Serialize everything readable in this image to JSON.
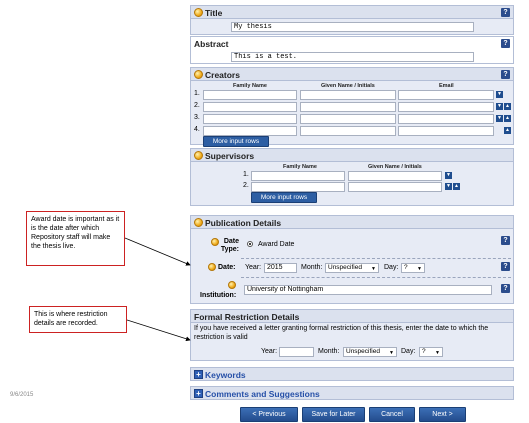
{
  "title_section": {
    "label": "Title",
    "value": "My thesis"
  },
  "abstract_section": {
    "label": "Abstract",
    "value": "This is a test."
  },
  "creators": {
    "label": "Creators",
    "col_family": "Family Name",
    "col_given": "Given Name / Initials",
    "col_email": "Email",
    "rows": [
      "1.",
      "2.",
      "3.",
      "4."
    ],
    "more_button": "More input rows"
  },
  "supervisors": {
    "label": "Supervisors",
    "col_family": "Family Name",
    "col_given": "Given Name / Initials",
    "rows": [
      "1.",
      "2."
    ],
    "more_button": "More input rows"
  },
  "publication": {
    "label": "Publication Details",
    "date_type_label": "Date Type:",
    "date_type_option": "Award Date",
    "date_label": "Date:",
    "year_label": "Year:",
    "year_value": "2015",
    "month_label": "Month:",
    "month_value": "Unspecified",
    "day_label": "Day:",
    "day_value": "?",
    "institution_label": "Institution:",
    "institution_value": "University of Nottingham"
  },
  "restriction": {
    "label": "Formal Restriction Details",
    "description": "If you have received a letter granting formal restriction of this thesis, enter the date to which the restriction is valid",
    "year_label": "Year:",
    "year_value": "",
    "month_label": "Month:",
    "month_value": "Unspecified",
    "day_label": "Day:",
    "day_value": "?"
  },
  "keywords": {
    "label": "Keywords"
  },
  "comments": {
    "label": "Comments and Suggestions"
  },
  "nav": {
    "prev": "< Previous",
    "save": "Save for Later",
    "cancel": "Cancel",
    "next": "Next >"
  },
  "callouts": {
    "award": "Award date is important as it is the date after which Repository staff will make the thesis live.",
    "restriction": "This is where restriction details are recorded."
  },
  "footer_date": "9/6/2015",
  "help_glyph": "?",
  "colors": {
    "panel": "#e7ebf5",
    "header": "#dbe1ee",
    "button": "#2d5ea3",
    "callout_border": "#cc2222"
  }
}
